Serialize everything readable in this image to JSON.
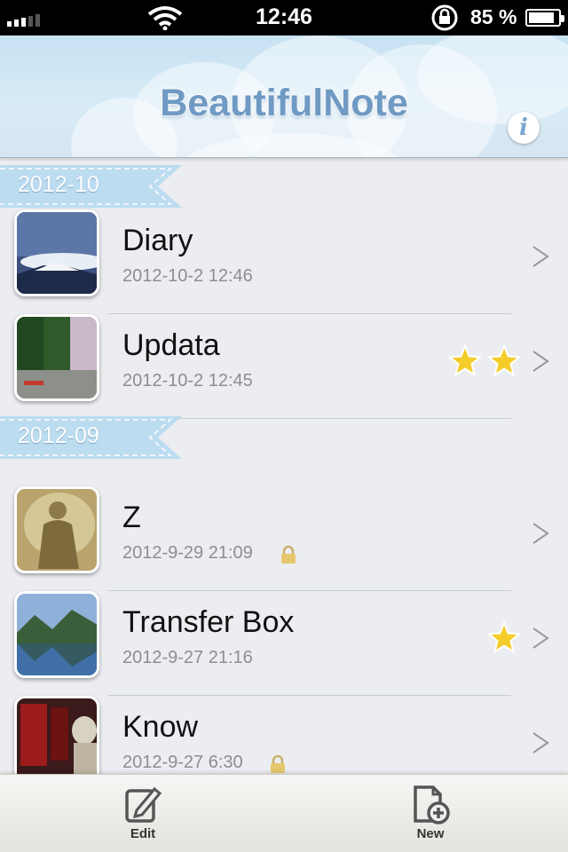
{
  "status_bar": {
    "time": "12:46",
    "battery_percent": "85 %",
    "battery_level": 0.85
  },
  "header": {
    "title": "BeautifulNote",
    "info_icon": "i"
  },
  "sections": [
    {
      "label": "2012-10",
      "notes": [
        {
          "title": "Diary",
          "date": "2012-10-2 12:46",
          "stars": 0,
          "locked": false,
          "thumb": "mountain-cloud"
        },
        {
          "title": "Updata",
          "date": "2012-10-2 12:45",
          "stars": 2,
          "locked": false,
          "thumb": "lake-forest"
        }
      ]
    },
    {
      "label": "2012-09",
      "notes": [
        {
          "title": "Z",
          "date": "2012-9-29 21:09",
          "stars": 0,
          "locked": true,
          "thumb": "statue-painting"
        },
        {
          "title": "Transfer Box",
          "date": "2012-9-27 21:16",
          "stars": 1,
          "locked": false,
          "thumb": "fjord"
        },
        {
          "title": "Know",
          "date": "2012-9-27 6:30",
          "stars": 0,
          "locked": true,
          "thumb": "red-figures"
        }
      ]
    }
  ],
  "chevron_glyph": ">",
  "toolbar": {
    "edit_label": "Edit",
    "new_label": "New"
  },
  "colors": {
    "header_bg": "#c7e2f3",
    "title_color": "#6f9ac4",
    "ribbon": "#bcdcf0",
    "star": "#f4cd2a"
  }
}
